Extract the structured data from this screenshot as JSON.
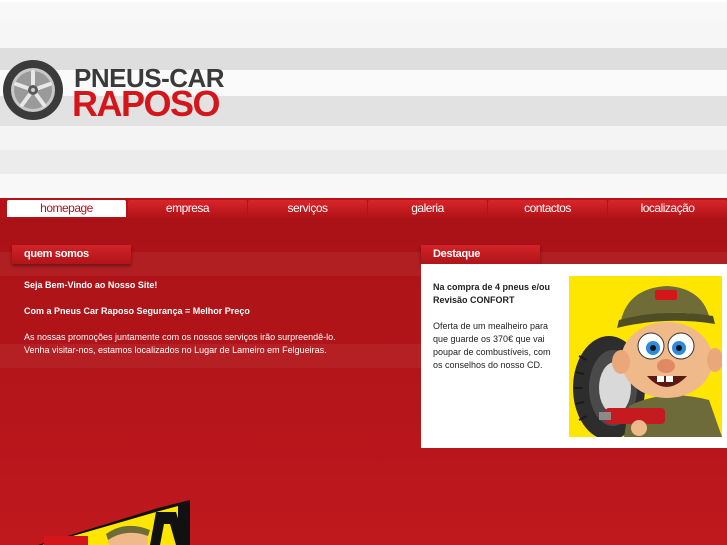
{
  "logo": {
    "line1": "PNEUS-CAR",
    "line2": "RAPOSO"
  },
  "nav": {
    "items": [
      {
        "label": "homepage"
      },
      {
        "label": "empresa"
      },
      {
        "label": "serviços"
      },
      {
        "label": "galeria"
      },
      {
        "label": "contactos"
      },
      {
        "label": "localização"
      }
    ],
    "active": "homepage"
  },
  "about": {
    "title": "quem somos",
    "welcome": "Seja Bem-Vindo ao Nosso Site!",
    "slogan": "Com a Pneus Car Raposo Segurança = Melhor Preço",
    "body_line1": "As nossas promoções juntamente com os nossos serviços irão surpreendê-lo.",
    "body_line2": "Venha visitar-nos, estamos localizados no Lugar de Lameiro em Felgueiras."
  },
  "featured": {
    "title": "Destaque",
    "headline": "Na compra de 4 pneus e/ou Revisão CONFORT",
    "body": "Oferta de um mealheiro para que guarde os 370€ que vai poupar de combustíveis, com os conselhos do nosso CD."
  },
  "colors": {
    "brand_red": "#d4161b",
    "dark_red": "#b01419",
    "logo_gray": "#3a3a3a"
  },
  "icons": {
    "logo": "wheel-icon",
    "mascot": "tire-mascot-image",
    "promo": "promo-banner-image"
  }
}
